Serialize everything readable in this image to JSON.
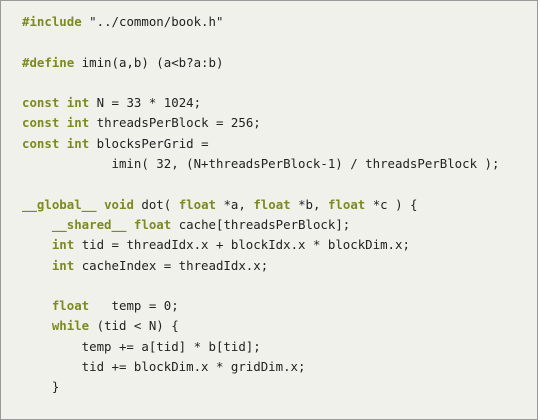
{
  "listing": {
    "lines": [
      [
        {
          "t": "#include",
          "c": "kw"
        },
        {
          "t": " \"../common/book.h\"",
          "c": "str"
        }
      ],
      [],
      [
        {
          "t": "#define",
          "c": "kw"
        },
        {
          "t": " imin(a,b) (a<b?a:b)",
          "c": ""
        }
      ],
      [],
      [
        {
          "t": "const",
          "c": "kw"
        },
        {
          "t": " ",
          "c": ""
        },
        {
          "t": "int",
          "c": "kw"
        },
        {
          "t": " N = 33 * 1024;",
          "c": ""
        }
      ],
      [
        {
          "t": "const",
          "c": "kw"
        },
        {
          "t": " ",
          "c": ""
        },
        {
          "t": "int",
          "c": "kw"
        },
        {
          "t": " threadsPerBlock = 256;",
          "c": ""
        }
      ],
      [
        {
          "t": "const",
          "c": "kw"
        },
        {
          "t": " ",
          "c": ""
        },
        {
          "t": "int",
          "c": "kw"
        },
        {
          "t": " blocksPerGrid =",
          "c": ""
        }
      ],
      [
        {
          "t": "            imin( 32, (N+threadsPerBlock-1) / threadsPerBlock );",
          "c": ""
        }
      ],
      [],
      [
        {
          "t": "__global__",
          "c": "kw"
        },
        {
          "t": " ",
          "c": ""
        },
        {
          "t": "void",
          "c": "kw"
        },
        {
          "t": " dot( ",
          "c": ""
        },
        {
          "t": "float",
          "c": "kw"
        },
        {
          "t": " *a, ",
          "c": ""
        },
        {
          "t": "float",
          "c": "kw"
        },
        {
          "t": " *b, ",
          "c": ""
        },
        {
          "t": "float",
          "c": "kw"
        },
        {
          "t": " *c ) {",
          "c": ""
        }
      ],
      [
        {
          "t": "    ",
          "c": ""
        },
        {
          "t": "__shared__",
          "c": "kw"
        },
        {
          "t": " ",
          "c": ""
        },
        {
          "t": "float",
          "c": "kw"
        },
        {
          "t": " cache[threadsPerBlock];",
          "c": ""
        }
      ],
      [
        {
          "t": "    ",
          "c": ""
        },
        {
          "t": "int",
          "c": "kw"
        },
        {
          "t": " tid = threadIdx.x + blockIdx.x * blockDim.x;",
          "c": ""
        }
      ],
      [
        {
          "t": "    ",
          "c": ""
        },
        {
          "t": "int",
          "c": "kw"
        },
        {
          "t": " cacheIndex = threadIdx.x;",
          "c": ""
        }
      ],
      [],
      [
        {
          "t": "    ",
          "c": ""
        },
        {
          "t": "float",
          "c": "kw"
        },
        {
          "t": "   temp = 0;",
          "c": ""
        }
      ],
      [
        {
          "t": "    ",
          "c": ""
        },
        {
          "t": "while",
          "c": "kw"
        },
        {
          "t": " (tid < N) {",
          "c": ""
        }
      ],
      [
        {
          "t": "        temp += a[tid] * b[tid];",
          "c": ""
        }
      ],
      [
        {
          "t": "        tid += blockDim.x * gridDim.x;",
          "c": ""
        }
      ],
      [
        {
          "t": "    }",
          "c": ""
        }
      ]
    ]
  },
  "colors": {
    "background": "#f1f1ec",
    "border": "#9a9a9a",
    "keyword": "#7c8a1e",
    "text": "#222222"
  }
}
